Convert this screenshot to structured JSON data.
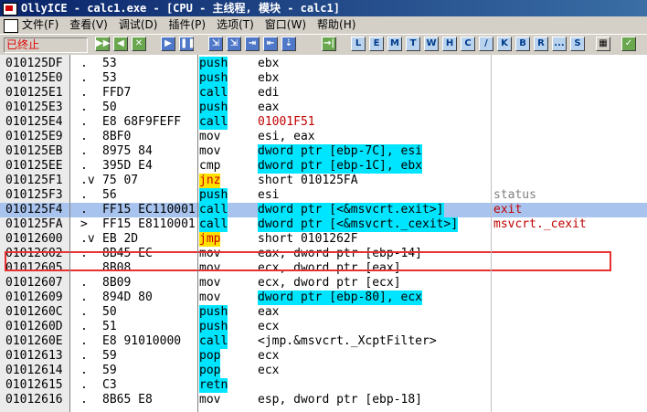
{
  "title": "OllyICE - calc1.exe - [CPU - 主线程, 模块 - calc1]",
  "menu": [
    "文件(F)",
    "查看(V)",
    "调试(D)",
    "插件(P)",
    "选项(T)",
    "窗口(W)",
    "帮助(H)"
  ],
  "status": "已终止",
  "toolbar": [
    "▶▶",
    "◀",
    "✕",
    "▶",
    "❚❚",
    "⇲",
    "⇲",
    "⇥",
    "⇤",
    "⇣",
    "→|",
    "L",
    "E",
    "M",
    "T",
    "W",
    "H",
    "C",
    "/",
    "K",
    "B",
    "R",
    "...",
    "S",
    "▦",
    "✓"
  ],
  "rows": [
    {
      "addr": "010125DF",
      "mark": ".",
      "hex": "53",
      "mn": "push",
      "op": "ebx",
      "cm": ""
    },
    {
      "addr": "010125E0",
      "mark": ".",
      "hex": "53",
      "mn": "push",
      "op": "ebx",
      "cm": ""
    },
    {
      "addr": "010125E1",
      "mark": ".",
      "hex": "FFD7",
      "mn": "call",
      "op": "edi",
      "cm": ""
    },
    {
      "addr": "010125E3",
      "mark": ".",
      "hex": "50",
      "mn": "push",
      "op": "eax",
      "cm": ""
    },
    {
      "addr": "010125E4",
      "mark": ".",
      "hex": "E8 68F9FEFF",
      "mn": "call",
      "op": "01001F51",
      "cm": ""
    },
    {
      "addr": "010125E9",
      "mark": ".",
      "hex": "8BF0",
      "mn": "mov",
      "op": "esi, eax",
      "cm": ""
    },
    {
      "addr": "010125EB",
      "mark": ".",
      "hex": "8975 84",
      "mn": "mov",
      "op": "dword ptr [ebp-7C], esi",
      "cm": ""
    },
    {
      "addr": "010125EE",
      "mark": ".",
      "hex": "395D E4",
      "mn": "cmp",
      "op": "dword ptr [ebp-1C], ebx",
      "cm": ""
    },
    {
      "addr": "010125F1",
      "mark": ".v",
      "hex": "75 07",
      "mn": "jnz",
      "op": "short 010125FA",
      "cm": ""
    },
    {
      "addr": "010125F3",
      "mark": ".",
      "hex": "56",
      "mn": "push",
      "op": "esi",
      "cm": "status"
    },
    {
      "addr": "010125F4",
      "mark": ".",
      "hex": "FF15 EC110001",
      "mn": "call",
      "op": "dword ptr [<&msvcrt.exit>]",
      "cm": "exit"
    },
    {
      "addr": "010125FA",
      "mark": ">",
      "hex": "FF15 E8110001",
      "mn": "call",
      "op": "dword ptr [<&msvcrt._cexit>]",
      "cm": "msvcrt._cexit"
    },
    {
      "addr": "01012600",
      "mark": ".v",
      "hex": "EB 2D",
      "mn": "jmp",
      "op": "short 0101262F",
      "cm": ""
    },
    {
      "addr": "01012602",
      "mark": ".",
      "hex": "8B45 EC",
      "mn": "mov",
      "op": "eax, dword ptr [ebp-14]",
      "cm": ""
    },
    {
      "addr": "01012605",
      "mark": ".",
      "hex": "8B08",
      "mn": "mov",
      "op": "ecx, dword ptr [eax]",
      "cm": ""
    },
    {
      "addr": "01012607",
      "mark": ".",
      "hex": "8B09",
      "mn": "mov",
      "op": "ecx, dword ptr [ecx]",
      "cm": ""
    },
    {
      "addr": "01012609",
      "mark": ".",
      "hex": "894D 80",
      "mn": "mov",
      "op": "dword ptr [ebp-80], ecx",
      "cm": ""
    },
    {
      "addr": "0101260C",
      "mark": ".",
      "hex": "50",
      "mn": "push",
      "op": "eax",
      "cm": ""
    },
    {
      "addr": "0101260D",
      "mark": ".",
      "hex": "51",
      "mn": "push",
      "op": "ecx",
      "cm": ""
    },
    {
      "addr": "0101260E",
      "mark": ".",
      "hex": "E8 91010000",
      "mn": "call",
      "op": "<jmp.&msvcrt._XcptFilter>",
      "cm": ""
    },
    {
      "addr": "01012613",
      "mark": ".",
      "hex": "59",
      "mn": "pop",
      "op": "ecx",
      "cm": ""
    },
    {
      "addr": "01012614",
      "mark": ".",
      "hex": "59",
      "mn": "pop",
      "op": "ecx",
      "cm": ""
    },
    {
      "addr": "01012615",
      "mark": ".",
      "hex": "C3",
      "mn": "retn",
      "op": "",
      "cm": ""
    },
    {
      "addr": "01012616",
      "mark": ".",
      "hex": "8B65 E8",
      "mn": "mov",
      "op": "esp, dword ptr [ebp-18]",
      "cm": ""
    }
  ]
}
